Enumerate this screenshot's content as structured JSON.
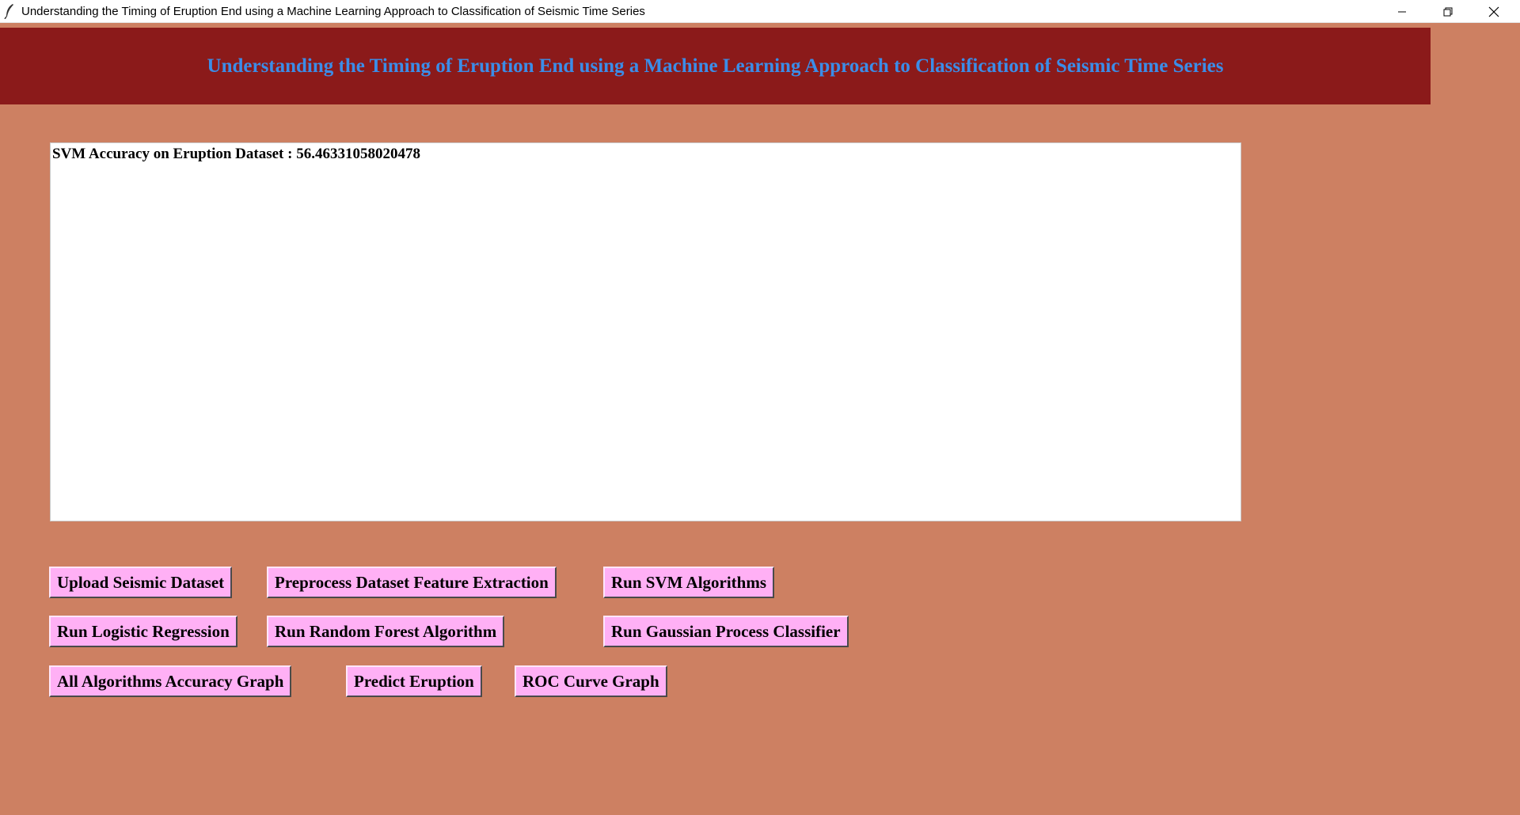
{
  "window": {
    "title": "Understanding the Timing of Eruption End using a Machine Learning Approach to Classification of Seismic Time Series",
    "controls": [
      "minimize-icon",
      "restore-icon",
      "close-icon"
    ]
  },
  "header": {
    "title": "Understanding the Timing of Eruption End using a Machine Learning Approach to Classification of Seismic Time Series"
  },
  "output": {
    "text": "SVM Accuracy on Eruption Dataset : 56.46331058020478"
  },
  "buttons": {
    "upload": "Upload Seismic Dataset",
    "preprocess": "Preprocess Dataset Feature Extraction",
    "svm": "Run SVM Algorithms",
    "logistic": "Run Logistic Regression",
    "random_forest": "Run Random Forest Algorithm",
    "gaussian": "Run Gaussian Process Classifier",
    "accuracy_graph": "All Algorithms Accuracy Graph",
    "predict": "Predict Eruption",
    "roc": "ROC Curve Graph"
  },
  "colors": {
    "background": "#cd8062",
    "header_bg": "#8b1a1a",
    "header_text": "#3b8de8",
    "button_bg": "#ffb0f5"
  }
}
